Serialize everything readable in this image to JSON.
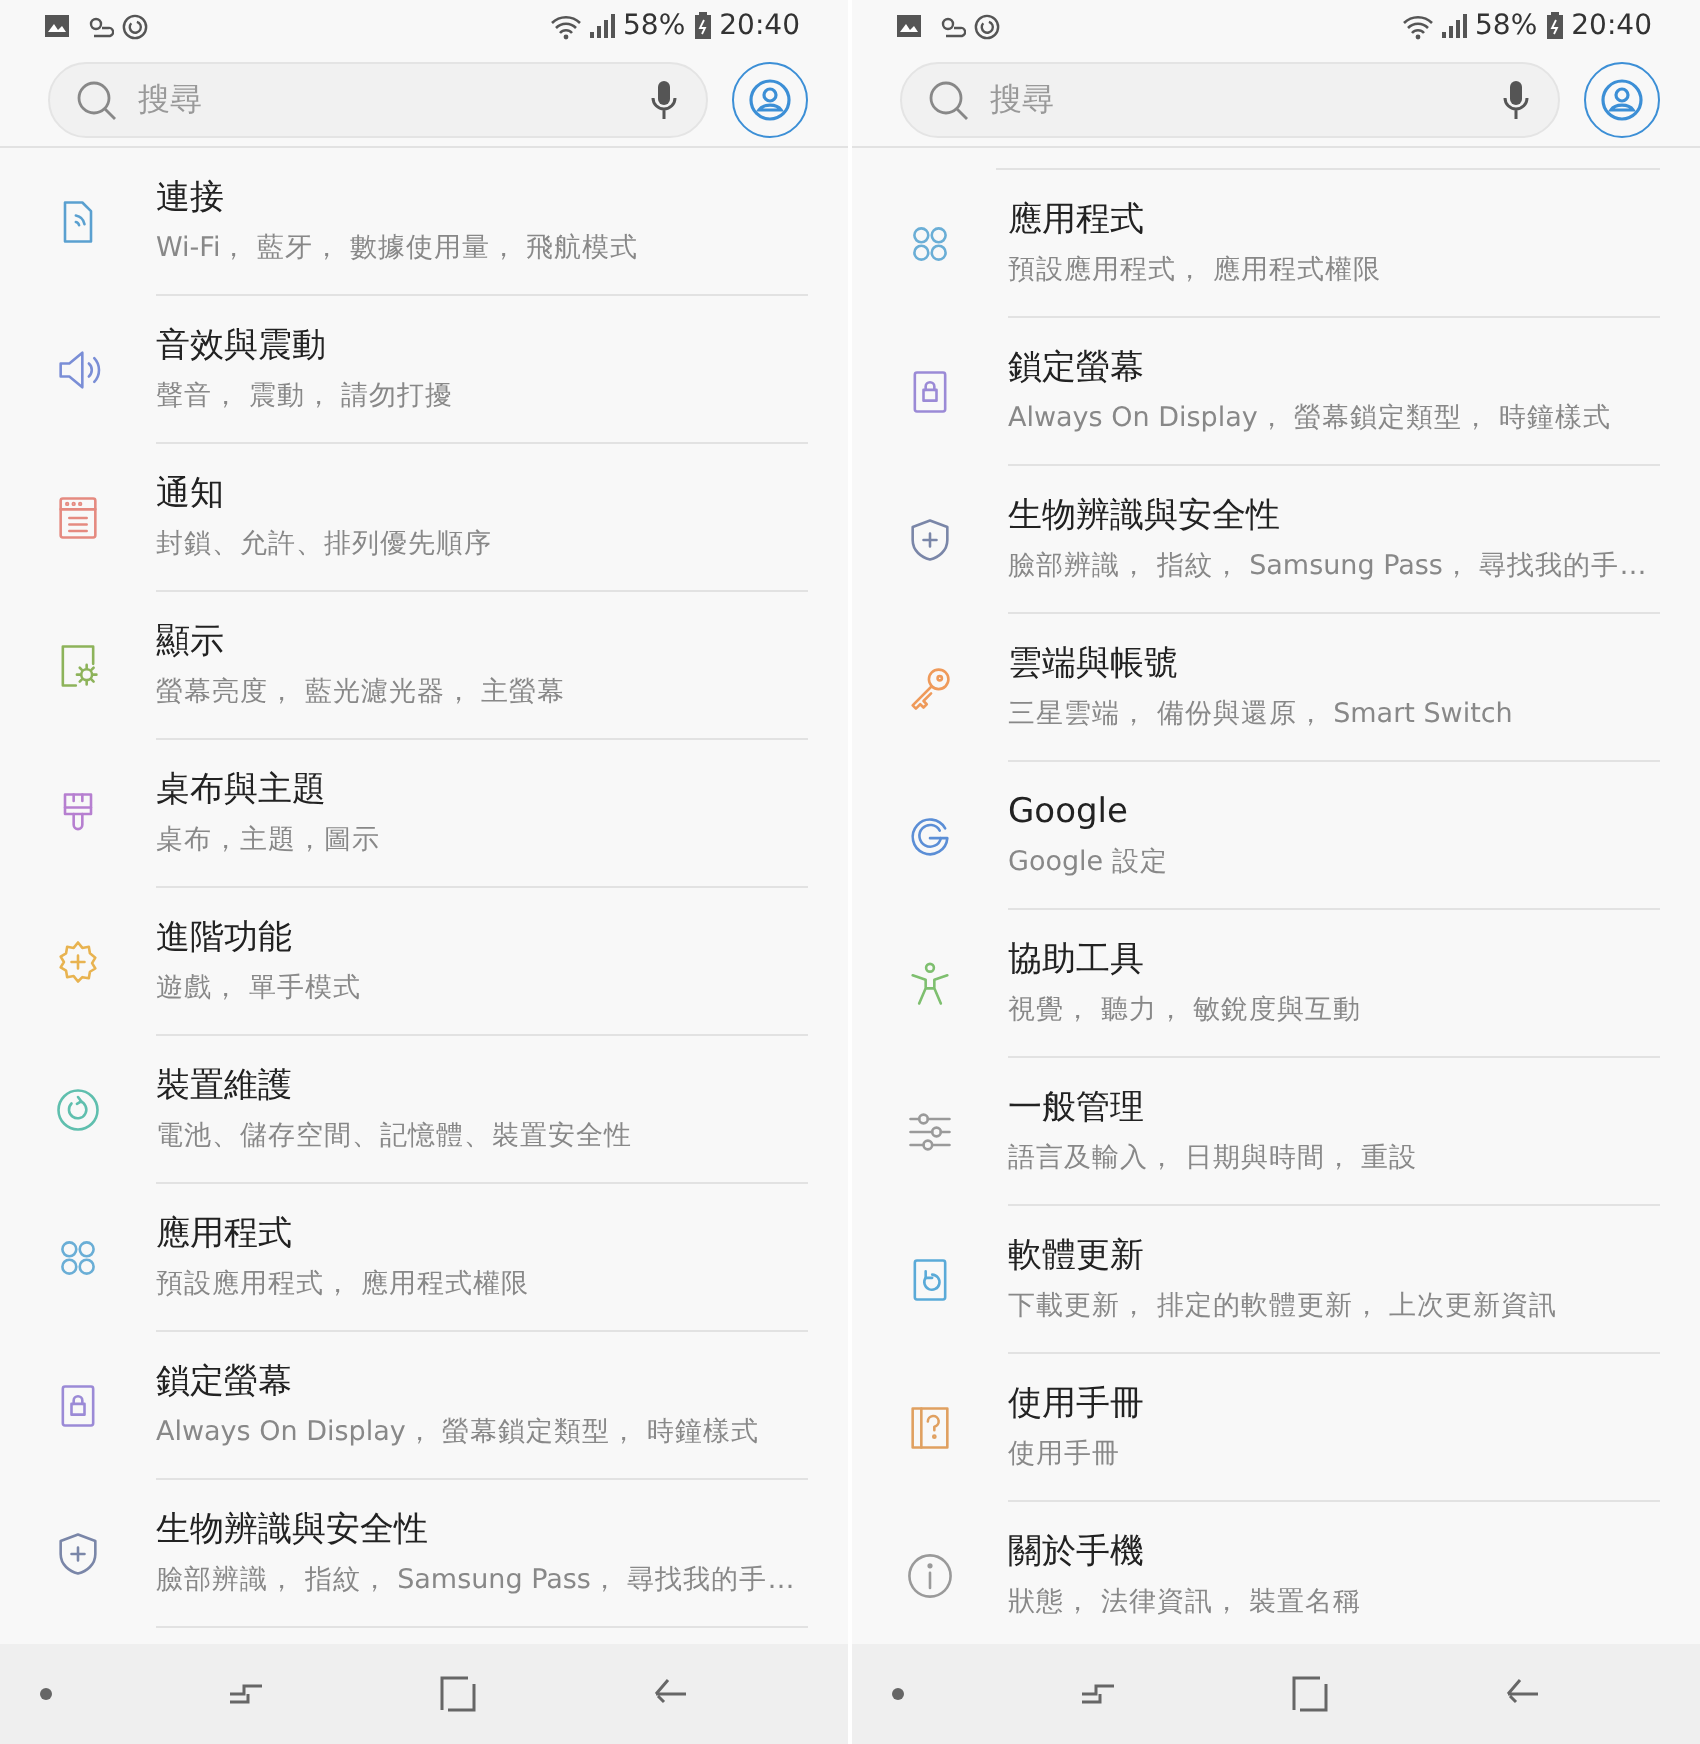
{
  "screens": [
    {
      "status_bar": {
        "battery": "58%",
        "time": "20:40"
      },
      "search": {
        "placeholder": "搜尋"
      },
      "items": [
        {
          "kind": "connections",
          "title": "連接",
          "subtitle": "Wi-Fi， 藍牙， 數據使用量， 飛航模式"
        },
        {
          "kind": "sound",
          "title": "音效與震動",
          "subtitle": "聲音， 震動， 請勿打擾"
        },
        {
          "kind": "notifications",
          "title": "通知",
          "subtitle": "封鎖、允許、排列優先順序"
        },
        {
          "kind": "display",
          "title": "顯示",
          "subtitle": "螢幕亮度， 藍光濾光器， 主螢幕"
        },
        {
          "kind": "wallpaper",
          "title": "桌布與主題",
          "subtitle": "桌布，主題，圖示"
        },
        {
          "kind": "advanced",
          "title": "進階功能",
          "subtitle": "遊戲， 單手模式"
        },
        {
          "kind": "maintenance",
          "title": "裝置維護",
          "subtitle": "電池、儲存空間、記憶體、裝置安全性"
        },
        {
          "kind": "apps",
          "title": "應用程式",
          "subtitle": "預設應用程式， 應用程式權限"
        },
        {
          "kind": "lock",
          "title": "鎖定螢幕",
          "subtitle": "Always On Display， 螢幕鎖定類型， 時鐘樣式"
        },
        {
          "kind": "security",
          "title": "生物辨識與安全性",
          "subtitle": "臉部辨識， 指紋， Samsung Pass， 尋找我的手…"
        }
      ]
    },
    {
      "status_bar": {
        "battery": "58%",
        "time": "20:40"
      },
      "search": {
        "placeholder": "搜尋"
      },
      "items": [
        {
          "kind": "apps",
          "title": "應用程式",
          "subtitle": "預設應用程式， 應用程式權限"
        },
        {
          "kind": "lock",
          "title": "鎖定螢幕",
          "subtitle": "Always On Display， 螢幕鎖定類型， 時鐘樣式"
        },
        {
          "kind": "security",
          "title": "生物辨識與安全性",
          "subtitle": "臉部辨識， 指紋， Samsung Pass， 尋找我的手…"
        },
        {
          "kind": "cloud",
          "title": "雲端與帳號",
          "subtitle": "三星雲端， 備份與還原， Smart Switch"
        },
        {
          "kind": "google",
          "title": "Google",
          "subtitle": "Google 設定"
        },
        {
          "kind": "accessibility",
          "title": "協助工具",
          "subtitle": "視覺， 聽力， 敏銳度與互動"
        },
        {
          "kind": "general",
          "title": "一般管理",
          "subtitle": "語言及輸入， 日期與時間， 重設"
        },
        {
          "kind": "update",
          "title": "軟體更新",
          "subtitle": "下載更新， 排定的軟體更新， 上次更新資訊"
        },
        {
          "kind": "manual",
          "title": "使用手冊",
          "subtitle": "使用手冊"
        },
        {
          "kind": "about",
          "title": "關於手機",
          "subtitle": "狀態， 法律資訊， 裝置名稱"
        }
      ]
    }
  ]
}
